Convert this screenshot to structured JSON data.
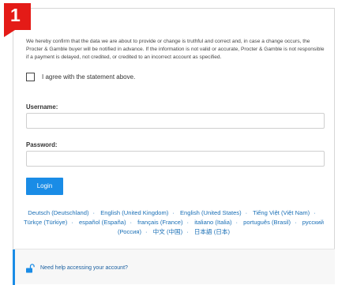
{
  "step": {
    "number": "1"
  },
  "disclaimer": "We hereby confirm that the data we are about to provide or change is truthful and correct and, in case a change occurs, the Procter & Gamble buyer will be notified in advance. If the information is not valid or accurate, Procter & Gamble is not responsible if a payment is delayed, not credited, or credited to an incorrect account as specified.",
  "agreement": {
    "label": "I agree with the statement above.",
    "checked": false
  },
  "form": {
    "username_label": "Username:",
    "username_value": "",
    "password_label": "Password:",
    "password_value": "",
    "login_label": "Login"
  },
  "languages": [
    "Deutsch (Deutschland)",
    "English (United Kingdom)",
    "English (United States)",
    "Tiếng Việt (Việt Nam)",
    "Türkçe (Türkiye)",
    "español (España)",
    "français (France)",
    "italiano (Italia)",
    "português (Brasil)",
    "русский (Россия)",
    "中文 (中国)",
    "日本語 (日本)"
  ],
  "help": {
    "label": "Need help accessing your account?",
    "icon": "unlock-icon"
  },
  "colors": {
    "badge": "#e41b17",
    "accent": "#1a8ce6",
    "link": "#1a6fb6"
  }
}
